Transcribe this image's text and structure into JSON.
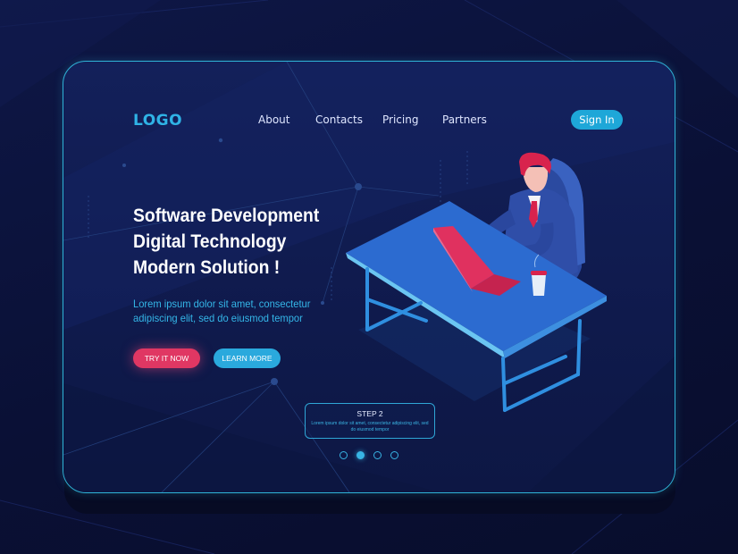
{
  "header": {
    "logo": "LOGO",
    "nav": {
      "about": "About",
      "contacts": "Contacts",
      "pricing": "Pricing",
      "partners": "Partners"
    },
    "sign_in": "Sign In"
  },
  "hero": {
    "headline": {
      "line1": "Software Development",
      "line2": "Digital Technology",
      "line3": "Modern Solution !"
    },
    "subtext": {
      "line1": "Lorem ipsum dolor sit amet, consectetur",
      "line2": "adipiscing elit, sed do eiusmod tempor"
    },
    "primary_button": "TRY IT NOW",
    "secondary_button": "LEARN MORE"
  },
  "step": {
    "title": "STEP 2",
    "text": "Lorem ipsum dolor sit amet, consectetur adipiscing elit, sed do eiusmod tempor"
  },
  "pagination": {
    "count": 4,
    "active": 2
  },
  "colors": {
    "accent": "#2fb3e6",
    "primary_button": "#e03763",
    "secondary_button": "#2aa9dd",
    "background": "#0b1238",
    "panel": "#13205a"
  },
  "icons": {
    "illustration": "man-at-desk-with-laptop-illustration"
  }
}
